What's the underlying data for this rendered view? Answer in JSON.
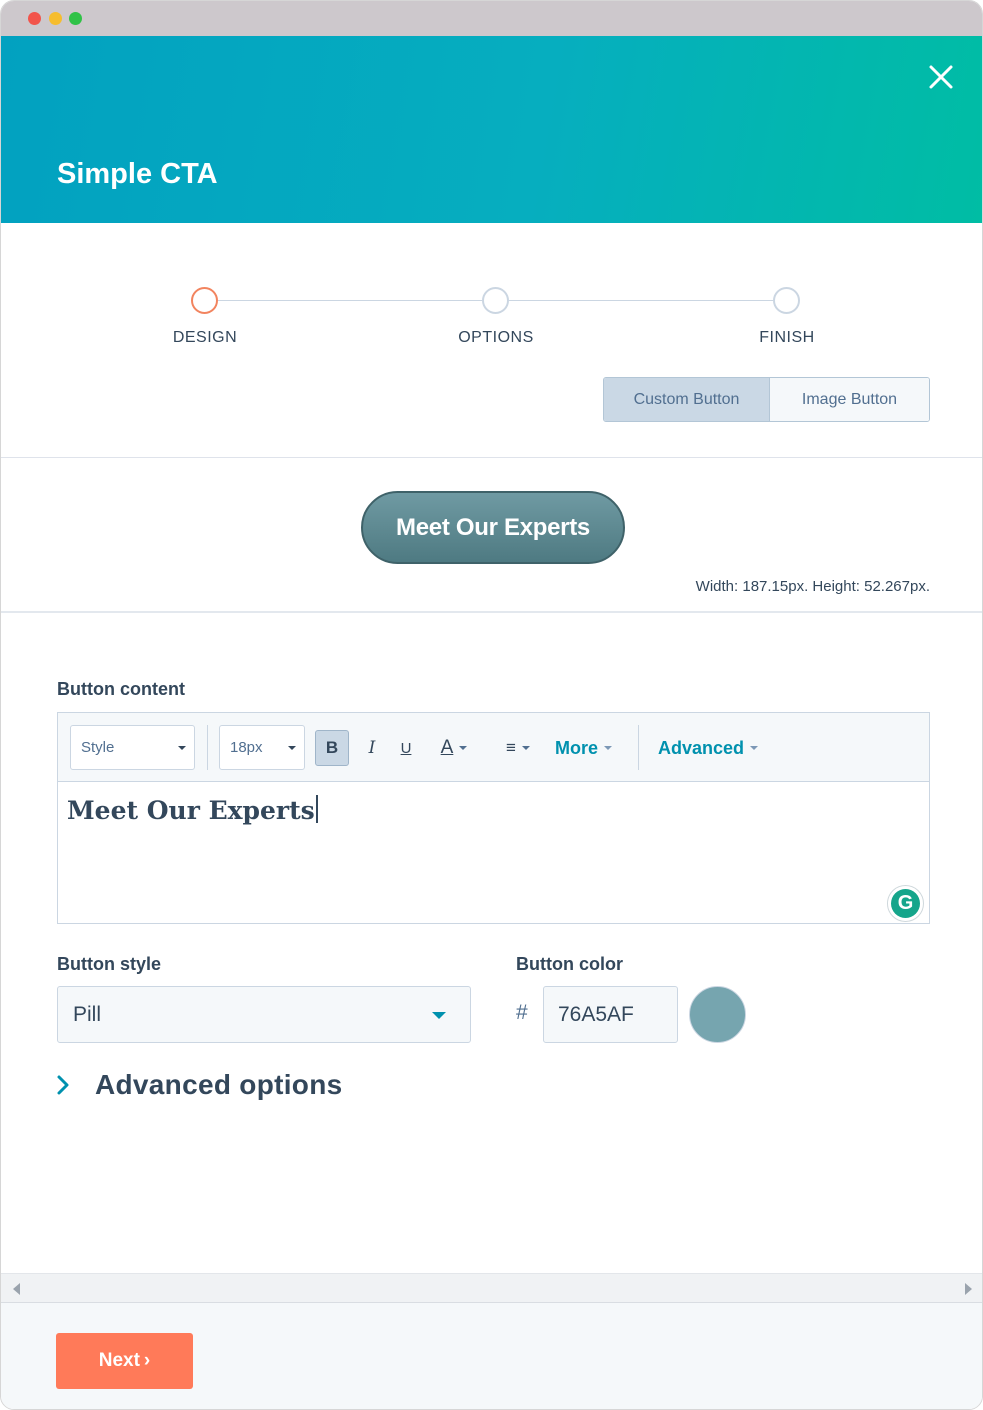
{
  "header": {
    "title": "Simple CTA"
  },
  "steps": [
    {
      "label": "DESIGN",
      "active": true
    },
    {
      "label": "OPTIONS",
      "active": false
    },
    {
      "label": "FINISH",
      "active": false
    }
  ],
  "button_type": {
    "custom_label": "Custom Button",
    "image_label": "Image Button",
    "selected": "Custom Button"
  },
  "preview": {
    "button_text": "Meet Our Experts",
    "dimensions": "Width: 187.15px. Height: 52.267px."
  },
  "content": {
    "label": "Button content",
    "toolbar": {
      "style_value": "Style",
      "size_value": "18px",
      "bold": "B",
      "italic": "I",
      "underline": "U",
      "font_color": "A",
      "align": "≡",
      "more": "More",
      "advanced": "Advanced"
    },
    "text": "Meet Our Experts",
    "grammarly": "G"
  },
  "style": {
    "label": "Button style",
    "value": "Pill"
  },
  "color": {
    "label": "Button color",
    "hash": "#",
    "value": "76A5AF",
    "swatch": "#76A5AF"
  },
  "advanced_options": {
    "label": "Advanced options"
  },
  "footer": {
    "next_label": "Next",
    "next_icon": "›"
  },
  "theme": {
    "accent": "#0091ae",
    "primary_button": "#ff7a59",
    "active_step": "#f2845f"
  }
}
